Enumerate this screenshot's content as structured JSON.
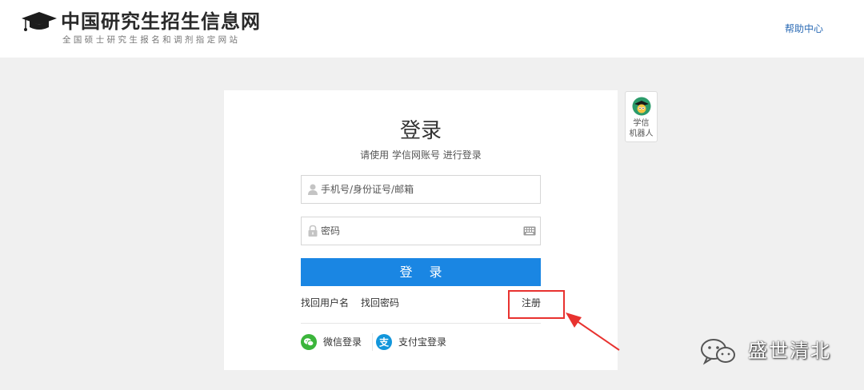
{
  "header": {
    "site_title": "中国研究生招生信息网",
    "site_subtitle": "全国硕士研究生报名和调剂指定网站",
    "help_link": "帮助中心"
  },
  "login": {
    "title": "登录",
    "subtitle": "请使用 学信网账号 进行登录",
    "username_placeholder": "手机号/身份证号/邮箱",
    "username_value": "",
    "password_placeholder": "密码",
    "password_value": "",
    "login_button": "登 录",
    "forgot_username": "找回用户名",
    "forgot_password": "找回密码",
    "register": "注册",
    "wechat_login": "微信登录",
    "alipay_login": "支付宝登录"
  },
  "robot": {
    "line1": "学信",
    "line2": "机器人"
  },
  "watermark": {
    "text": "盛世清北"
  },
  "colors": {
    "primary": "#1a86e3",
    "link": "#2b6bb5",
    "highlight": "#e8322f",
    "background": "#f0f0f0",
    "wechat": "#3bb53b",
    "alipay": "#1296db"
  },
  "icons": {
    "logo": "graduation-cap-icon",
    "username": "user-icon",
    "password": "lock-icon",
    "keyboard": "keyboard-icon",
    "wechat": "wechat-icon",
    "alipay": "alipay-icon",
    "robot": "robot-avatar-icon",
    "annotation": "red-arrow-icon"
  }
}
